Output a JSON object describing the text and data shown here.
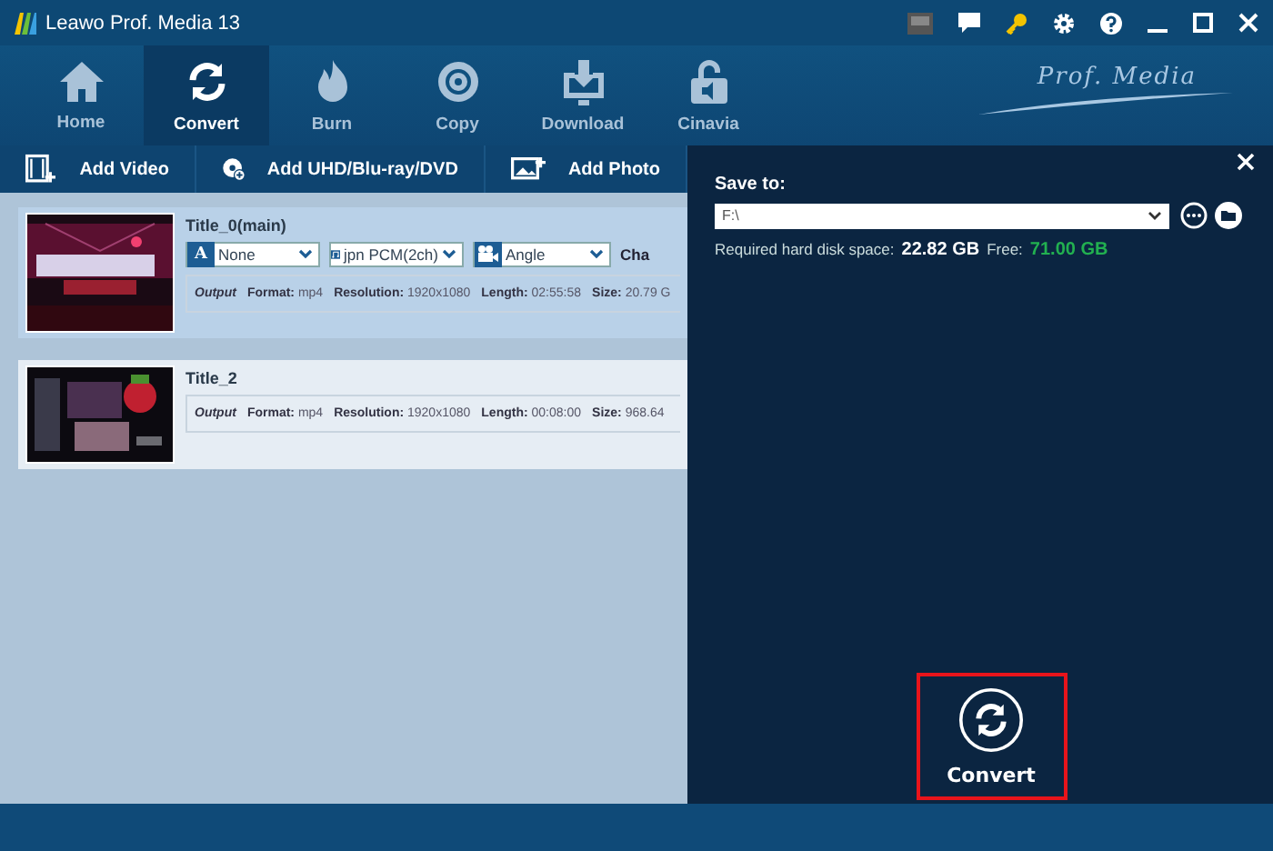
{
  "window": {
    "title": "Leawo Prof. Media 13"
  },
  "nav": {
    "items": [
      {
        "label": "Home",
        "selected": false
      },
      {
        "label": "Convert",
        "selected": true
      },
      {
        "label": "Burn",
        "selected": false
      },
      {
        "label": "Copy",
        "selected": false
      },
      {
        "label": "Download",
        "selected": false
      },
      {
        "label": "Cinavia",
        "selected": false
      }
    ],
    "brand": "Prof. Media"
  },
  "toolbar": {
    "buttons": [
      {
        "label": "Add Video"
      },
      {
        "label": "Add UHD/Blu-ray/DVD"
      },
      {
        "label": "Add Photo"
      }
    ]
  },
  "titles": [
    {
      "name": "Title_0(main)",
      "selected": true,
      "dropdowns": [
        {
          "kind": "subtitle",
          "badge": "A",
          "value": "None"
        },
        {
          "kind": "audio",
          "value": "jpn PCM(2ch)"
        },
        {
          "kind": "angle",
          "value": "Angle"
        }
      ],
      "extra_label": "Cha",
      "output_label": "Output",
      "details": [
        {
          "label": "Format:",
          "value": "mp4"
        },
        {
          "label": "Resolution:",
          "value": "1920x1080"
        },
        {
          "label": "Length:",
          "value": "02:55:58"
        },
        {
          "label": "Size:",
          "value": "20.79 G"
        }
      ]
    },
    {
      "name": "Title_2",
      "selected": false,
      "output_label": "Output",
      "details": [
        {
          "label": "Format:",
          "value": "mp4"
        },
        {
          "label": "Resolution:",
          "value": "1920x1080"
        },
        {
          "label": "Length:",
          "value": "00:08:00"
        },
        {
          "label": "Size:",
          "value": "968.64"
        }
      ]
    }
  ],
  "save_panel": {
    "save_to_label": "Save to:",
    "path": "F:\\",
    "required_label": "Required hard disk space:",
    "required": "22.82 GB",
    "free_label": "Free:",
    "free": "71.00 GB",
    "convert_button": {
      "label": "Convert",
      "highlighted": true
    }
  }
}
